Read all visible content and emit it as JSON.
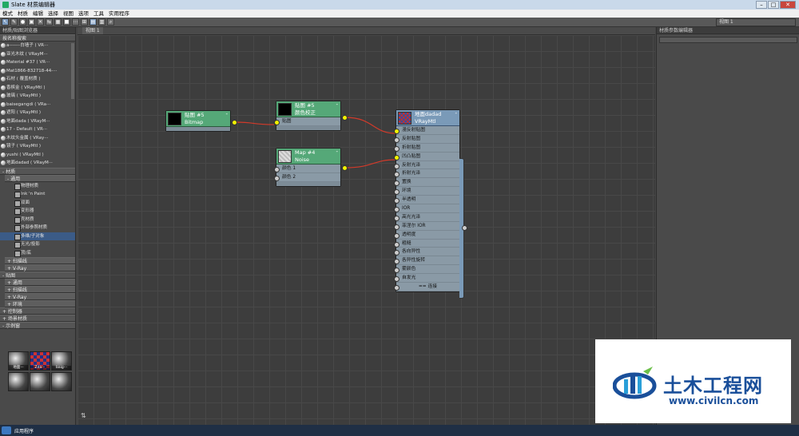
{
  "window": {
    "title": "Slate 材质编辑器"
  },
  "menu": [
    "模式",
    "材质",
    "编辑",
    "选择",
    "视图",
    "选项",
    "工具",
    "实用程序"
  ],
  "view_selector": "视图 1",
  "left_panel": {
    "header": "材质/贴图浏览器",
    "search_rollout": "按名称搜索",
    "scene_items": [
      "a-------白墙子 ( VR···",
      "亚光木纹 ( VRayM···",
      "Material #37 ( VR···",
      "Mat1866-832718-44-···",
      "石材 ( 覆盖材质 )",
      "香槟金 ( VRayMtl )",
      "玻璃 ( VRayMtl )",
      "baisegangdi ( VRa···",
      "遮阳 ( VRayMtl )",
      "地面dada ( VRayM···",
      "17 - Default ( VR···",
      "木纹头金属 ( VRay···",
      "镜子 ( VRayMtl )",
      "yushi ( VRayMtl )",
      "地面dadad ( VRayM···"
    ],
    "materials_rollout": "- 材质",
    "general_sub": "- 通用",
    "materials": [
      "物理材质",
      "Ink 'n Paint",
      "双面",
      "变形器",
      "壳材质",
      "外部参照材质",
      "多维/子对象",
      "无光/投影",
      "顶/底"
    ],
    "selected_material_index": 6,
    "scanline_sub": "+ 扫描线",
    "vray_sub": "+ V-Ray",
    "maps_rollout": "- 贴图",
    "maps_sub": [
      "+ 通用",
      "+ 扫描线",
      "+ V-Ray",
      "+ 环境"
    ],
    "controller_rollout": "+ 控制器",
    "scene_rollout": "+ 场景材质",
    "sample_rollout": "- 示例窗",
    "thumbs": [
      "地面···",
      "Zda···",
      "baig···",
      "",
      "",
      ""
    ]
  },
  "canvas": {
    "tab": "视图 1"
  },
  "right_panel": {
    "header": "材质参数编辑器"
  },
  "nodes": {
    "bitmap": {
      "title1": "贴图 #5",
      "title2": "Bitmap"
    },
    "color_correct": {
      "title1": "贴图 #5",
      "title2": "颜色校正",
      "slot": "贴图"
    },
    "noise": {
      "title1": "Map #4",
      "title2": "Noise",
      "slots": [
        "颜色 1",
        "颜色 2"
      ]
    },
    "vray": {
      "title1": "地面dadad",
      "title2": "VRayMtl",
      "slots": [
        "漫反射贴图",
        "反射贴图",
        "折射贴图",
        "凹凸贴图",
        "反射光泽",
        "折射光泽",
        "置换",
        "环境",
        "半透明",
        "IOR",
        "高光光泽",
        "菲涅尔 IOR",
        "透明度",
        "粗糙",
        "各向异性",
        "各异性旋转",
        "雾颜色",
        "自发光"
      ],
      "more": "== 连接"
    }
  },
  "taskbar": {
    "item": "应用程序"
  },
  "watermark": {
    "title": "土木工程网",
    "url": "www.civilcn.com"
  },
  "colors": {
    "node_green": "#55a878",
    "node_blue": "#7a9ab8",
    "wire": "#d23a2a",
    "port": "#f3f300"
  },
  "icons": [
    "pointer-icon",
    "eyedropper-icon",
    "material-icon",
    "layout-icon",
    "close-icon",
    "minimize-icon",
    "maximize-icon"
  ]
}
